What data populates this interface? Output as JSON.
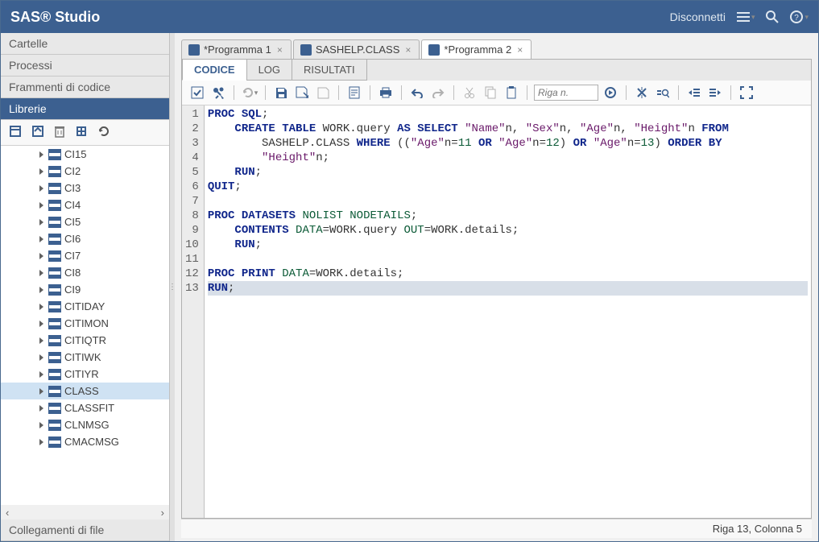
{
  "header": {
    "title": "SAS® Studio",
    "disconnect": "Disconnetti"
  },
  "sidebar": {
    "panels": {
      "folders": "Cartelle",
      "processes": "Processi",
      "snippets": "Frammenti di codice",
      "libraries": "Librerie",
      "filelinks": "Collegamenti di file"
    },
    "items": [
      "CI15",
      "CI2",
      "CI3",
      "CI4",
      "CI5",
      "CI6",
      "CI7",
      "CI8",
      "CI9",
      "CITIDAY",
      "CITIMON",
      "CITIQTR",
      "CITIWK",
      "CITIYR",
      "CLASS",
      "CLASSFIT",
      "CLNMSG",
      "CMACMSG"
    ],
    "selected": "CLASS"
  },
  "tabs": [
    {
      "label": "*Programma 1",
      "active": false
    },
    {
      "label": "SASHELP.CLASS",
      "active": false
    },
    {
      "label": "*Programma 2",
      "active": true
    }
  ],
  "subtabs": {
    "code": "CODICE",
    "log": "LOG",
    "results": "RISULTATI"
  },
  "toolbar": {
    "line_placeholder": "Riga n."
  },
  "code": {
    "lines": [
      [
        {
          "t": "PROC SQL",
          "c": "kw"
        },
        {
          "t": ";",
          "c": ""
        }
      ],
      [
        {
          "t": "    ",
          "c": ""
        },
        {
          "t": "CREATE TABLE",
          "c": "kw"
        },
        {
          "t": " WORK.query ",
          "c": ""
        },
        {
          "t": "AS SELECT",
          "c": "kw"
        },
        {
          "t": " ",
          "c": ""
        },
        {
          "t": "\"Name\"",
          "c": "str"
        },
        {
          "t": "n",
          "c": ""
        },
        {
          "t": ", ",
          "c": ""
        },
        {
          "t": "\"Sex\"",
          "c": "str"
        },
        {
          "t": "n",
          "c": ""
        },
        {
          "t": ", ",
          "c": ""
        },
        {
          "t": "\"Age\"",
          "c": "str"
        },
        {
          "t": "n",
          "c": ""
        },
        {
          "t": ", ",
          "c": ""
        },
        {
          "t": "\"Height\"",
          "c": "str"
        },
        {
          "t": "n ",
          "c": ""
        },
        {
          "t": "FROM",
          "c": "kw"
        }
      ],
      [
        {
          "t": "        SASHELP.CLASS ",
          "c": ""
        },
        {
          "t": "WHERE",
          "c": "kw"
        },
        {
          "t": " ((",
          "c": ""
        },
        {
          "t": "\"Age\"",
          "c": "str"
        },
        {
          "t": "n=",
          "c": ""
        },
        {
          "t": "11",
          "c": "ds"
        },
        {
          "t": " ",
          "c": ""
        },
        {
          "t": "OR",
          "c": "kw"
        },
        {
          "t": " ",
          "c": ""
        },
        {
          "t": "\"Age\"",
          "c": "str"
        },
        {
          "t": "n=",
          "c": ""
        },
        {
          "t": "12",
          "c": "ds"
        },
        {
          "t": ") ",
          "c": ""
        },
        {
          "t": "OR",
          "c": "kw"
        },
        {
          "t": " ",
          "c": ""
        },
        {
          "t": "\"Age\"",
          "c": "str"
        },
        {
          "t": "n=",
          "c": ""
        },
        {
          "t": "13",
          "c": "ds"
        },
        {
          "t": ") ",
          "c": ""
        },
        {
          "t": "ORDER BY",
          "c": "kw"
        }
      ],
      [
        {
          "t": "        ",
          "c": ""
        },
        {
          "t": "\"Height\"",
          "c": "str"
        },
        {
          "t": "n;",
          "c": ""
        }
      ],
      [
        {
          "t": "    ",
          "c": ""
        },
        {
          "t": "RUN",
          "c": "kw"
        },
        {
          "t": ";",
          "c": ""
        }
      ],
      [
        {
          "t": "QUIT",
          "c": "kw"
        },
        {
          "t": ";",
          "c": ""
        }
      ],
      [
        {
          "t": "",
          "c": ""
        }
      ],
      [
        {
          "t": "PROC DATASETS ",
          "c": "kw"
        },
        {
          "t": "NOLIST",
          "c": "ds"
        },
        {
          "t": " ",
          "c": ""
        },
        {
          "t": "NODETAILS",
          "c": "ds"
        },
        {
          "t": ";",
          "c": ""
        }
      ],
      [
        {
          "t": "    ",
          "c": ""
        },
        {
          "t": "CONTENTS",
          "c": "kw"
        },
        {
          "t": " ",
          "c": ""
        },
        {
          "t": "DATA",
          "c": "ds"
        },
        {
          "t": "=WORK.query ",
          "c": ""
        },
        {
          "t": "OUT",
          "c": "ds"
        },
        {
          "t": "=WORK.details;",
          "c": ""
        }
      ],
      [
        {
          "t": "    ",
          "c": ""
        },
        {
          "t": "RUN",
          "c": "kw"
        },
        {
          "t": ";",
          "c": ""
        }
      ],
      [
        {
          "t": "",
          "c": ""
        }
      ],
      [
        {
          "t": "PROC PRINT ",
          "c": "kw"
        },
        {
          "t": "DATA",
          "c": "ds"
        },
        {
          "t": "=WORK.details;",
          "c": ""
        }
      ],
      [
        {
          "t": "RUN",
          "c": "kw"
        },
        {
          "t": ";",
          "c": ""
        }
      ]
    ],
    "current_line": 13
  },
  "status": {
    "text": "Riga 13, Colonna 5"
  }
}
